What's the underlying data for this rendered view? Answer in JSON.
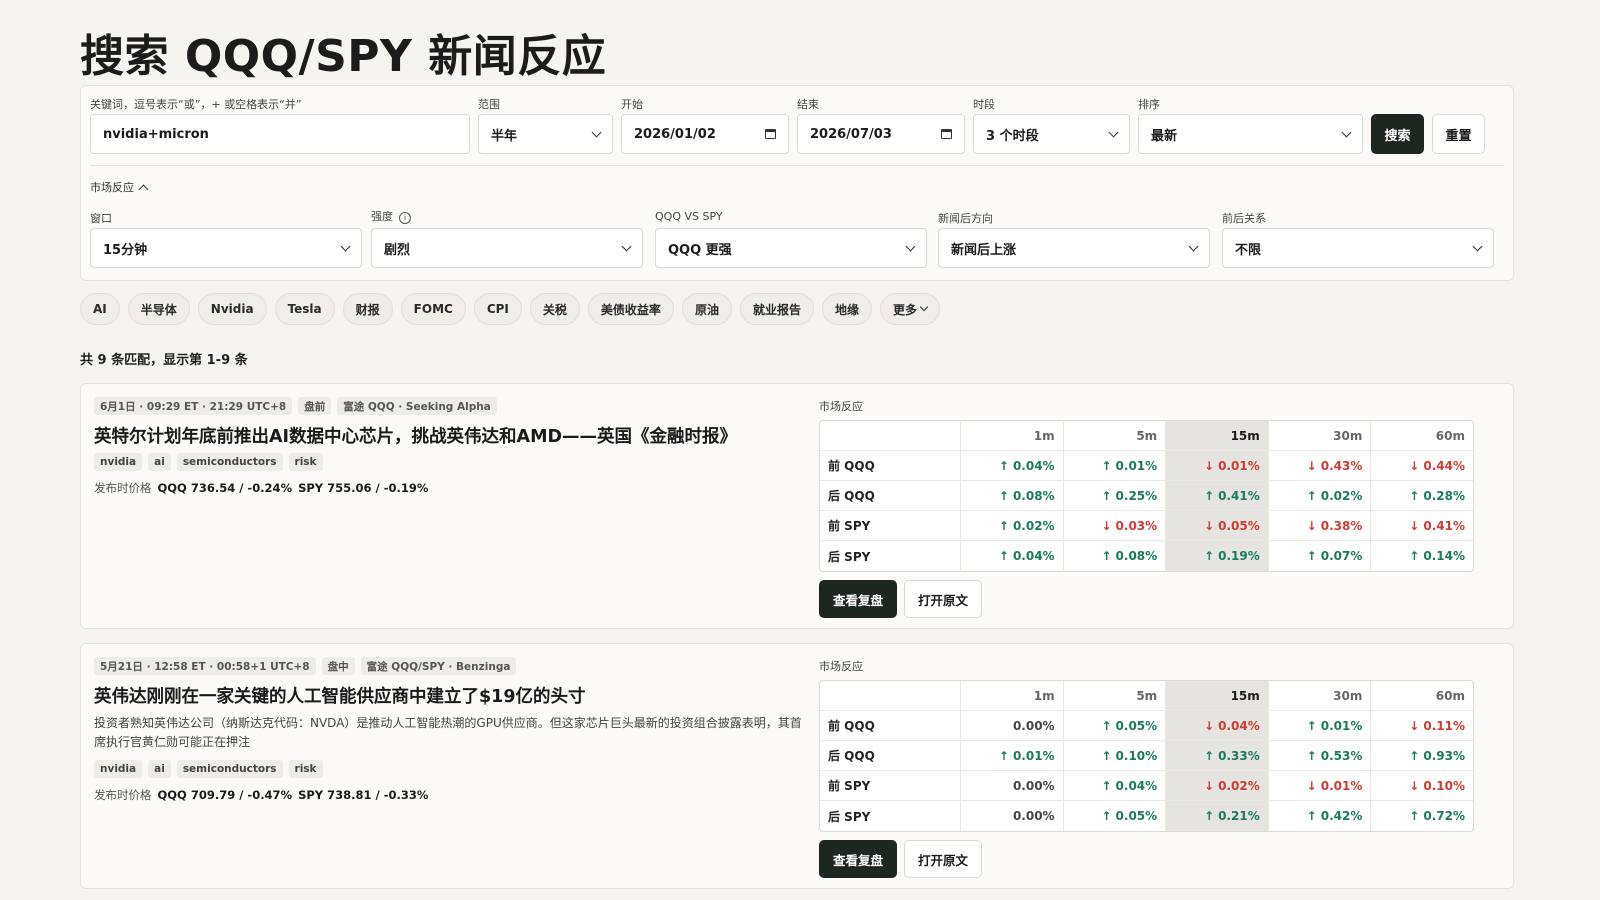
{
  "page": {
    "title": "搜索 QQQ/SPY 新闻反应"
  },
  "search": {
    "keyword_label": "关键词，逗号表示“或”，+ 或空格表示“并”",
    "keyword_value": "nvidia+micron",
    "range_label": "范围",
    "range_value": "半年",
    "start_label": "开始",
    "start_value": "2026/01/02",
    "end_label": "结束",
    "end_value": "2026/07/03",
    "session_label": "时段",
    "session_value": "3 个时段",
    "sort_label": "排序",
    "sort_value": "最新",
    "search_button": "搜索",
    "reset_button": "重置"
  },
  "market_filter": {
    "toggle_label": "市场反应",
    "window_label": "窗口",
    "window_value": "15分钟",
    "strength_label": "强度",
    "strength_value": "剧烈",
    "vs_label": "QQQ VS SPY",
    "vs_value": "QQQ 更强",
    "direction_label": "新闻后方向",
    "direction_value": "新闻后上涨",
    "relation_label": "前后关系",
    "relation_value": "不限"
  },
  "chips": [
    "AI",
    "半导体",
    "Nvidia",
    "Tesla",
    "财报",
    "FOMC",
    "CPI",
    "关税",
    "美债收益率",
    "原油",
    "就业报告",
    "地缘",
    "更多"
  ],
  "results_count": "共 9 条匹配，显示第 1-9 条",
  "table_headers": [
    "",
    "1m",
    "5m",
    "15m",
    "30m",
    "60m"
  ],
  "results": [
    {
      "time": "6月1日 · 09:29 ET · 21:29 UTC+8",
      "session": "盘前",
      "source": "富途 QQQ · Seeking Alpha",
      "headline": "英特尔计划年底前推出AI数据中心芯片，挑战英伟达和AMD——英国《金融时报》",
      "summary": "",
      "keywords": [
        "nvidia",
        "ai",
        "semiconductors",
        "risk"
      ],
      "price_label": "发布时价格",
      "qqq_price": "QQQ 736.54 / -0.24%",
      "spy_price": "SPY 755.06 / -0.19%",
      "reaction_label": "市场反应",
      "rows": [
        {
          "label": "前 QQQ",
          "values": [
            [
              "up",
              "0.04%"
            ],
            [
              "up",
              "0.01%"
            ],
            [
              "dn",
              "0.01%"
            ],
            [
              "dn",
              "0.43%"
            ],
            [
              "dn",
              "0.44%"
            ]
          ]
        },
        {
          "label": "后 QQQ",
          "values": [
            [
              "up",
              "0.08%"
            ],
            [
              "up",
              "0.25%"
            ],
            [
              "up",
              "0.41%"
            ],
            [
              "up",
              "0.02%"
            ],
            [
              "up",
              "0.28%"
            ]
          ]
        },
        {
          "label": "前 SPY",
          "values": [
            [
              "up",
              "0.02%"
            ],
            [
              "dn",
              "0.03%"
            ],
            [
              "dn",
              "0.05%"
            ],
            [
              "dn",
              "0.38%"
            ],
            [
              "dn",
              "0.41%"
            ]
          ]
        },
        {
          "label": "后 SPY",
          "values": [
            [
              "up",
              "0.04%"
            ],
            [
              "up",
              "0.08%"
            ],
            [
              "up",
              "0.19%"
            ],
            [
              "up",
              "0.07%"
            ],
            [
              "up",
              "0.14%"
            ]
          ]
        }
      ],
      "review_button": "查看复盘",
      "open_button": "打开原文"
    },
    {
      "time": "5月21日 · 12:58 ET · 00:58+1 UTC+8",
      "session": "盘中",
      "source": "富途 QQQ/SPY · Benzinga",
      "headline": "英伟达刚刚在一家关键的人工智能供应商中建立了$19亿的头寸",
      "summary": "投资者熟知英伟达公司（纳斯达克代码：NVDA）是推动人工智能热潮的GPU供应商。但这家芯片巨头最新的投资组合披露表明，其首席执行官黄仁勋可能正在押注",
      "keywords": [
        "nvidia",
        "ai",
        "semiconductors",
        "risk"
      ],
      "price_label": "发布时价格",
      "qqq_price": "QQQ 709.79 / -0.47%",
      "spy_price": "SPY 738.81 / -0.33%",
      "reaction_label": "市场反应",
      "rows": [
        {
          "label": "前 QQQ",
          "values": [
            [
              "flat",
              "0.00%"
            ],
            [
              "up",
              "0.05%"
            ],
            [
              "dn",
              "0.04%"
            ],
            [
              "up",
              "0.01%"
            ],
            [
              "dn",
              "0.11%"
            ]
          ]
        },
        {
          "label": "后 QQQ",
          "values": [
            [
              "up",
              "0.01%"
            ],
            [
              "up",
              "0.10%"
            ],
            [
              "up",
              "0.33%"
            ],
            [
              "up",
              "0.53%"
            ],
            [
              "up",
              "0.93%"
            ]
          ]
        },
        {
          "label": "前 SPY",
          "values": [
            [
              "flat",
              "0.00%"
            ],
            [
              "up",
              "0.04%"
            ],
            [
              "dn",
              "0.02%"
            ],
            [
              "dn",
              "0.01%"
            ],
            [
              "dn",
              "0.10%"
            ]
          ]
        },
        {
          "label": "后 SPY",
          "values": [
            [
              "flat",
              "0.00%"
            ],
            [
              "up",
              "0.05%"
            ],
            [
              "up",
              "0.21%"
            ],
            [
              "up",
              "0.42%"
            ],
            [
              "up",
              "0.72%"
            ]
          ]
        }
      ],
      "review_button": "查看复盘",
      "open_button": "打开原文"
    }
  ],
  "colors": {
    "up": "#1a7a5e",
    "down": "#d03b32",
    "dark_button": "#1e2622",
    "highlight_col": "#e5e4e0"
  }
}
